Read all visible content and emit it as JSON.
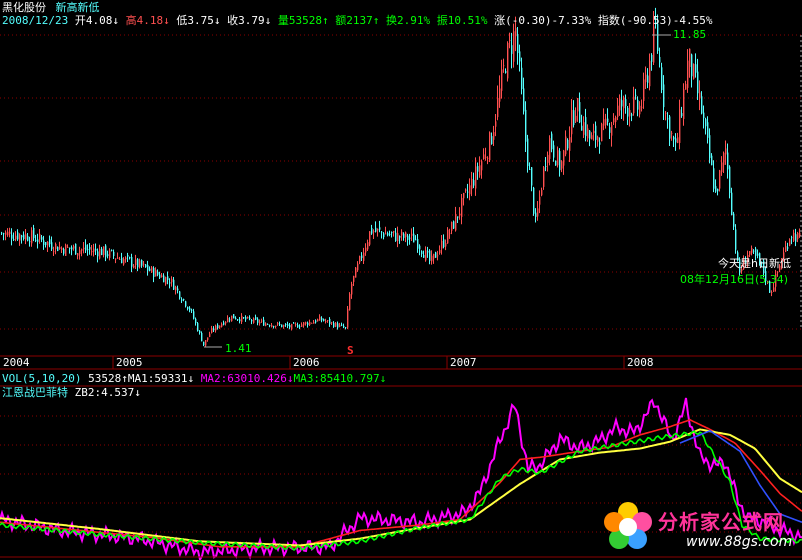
{
  "stock": {
    "name": "黑化股份",
    "indicator_name": "新高新低",
    "date": "2008/12/23",
    "open_label": "开",
    "open": "4.08",
    "high_label": "高",
    "high": "4.18",
    "low_label": "低",
    "low": "3.75",
    "close_label": "收",
    "close": "3.79",
    "volume_label": "量",
    "volume": "53528",
    "amount_label": "额",
    "amount": "2137",
    "turnover_label": "换",
    "turnover": "2.91%",
    "amplitude_label": "振",
    "amplitude": "10.51%",
    "change_label": "涨",
    "change": "(-0.30)-7.33%",
    "index_label": "指数",
    "index_change": "(-90.53)-4.55%",
    "arrows": {
      "down": "↓",
      "up": "↑"
    }
  },
  "price_panel": {
    "max_marker": "11.85",
    "min_marker": "1.41",
    "signal_marker": "S",
    "overlay_today": "今天是h日新低",
    "overlay_date": "08年12月16日(5.34)",
    "year_labels": [
      "2004",
      "2005",
      "2006",
      "2007",
      "2008"
    ]
  },
  "volume_panel": {
    "title": "VOL(5,10,20)",
    "value": "53528",
    "ma1_label": "MA1:",
    "ma1": "59331",
    "ma2_label": "MA2:",
    "ma2": "63010.426",
    "ma3_label": "MA3:",
    "ma3": "85410.797"
  },
  "indicator_panel": {
    "title": "江恩战巴菲特",
    "zb2_label": "ZB2:",
    "zb2": "4.537"
  },
  "watermark": {
    "brand": "分析家公式网",
    "url": "www.88gs.com"
  },
  "colors": {
    "background": "#000000",
    "grid": "#8b0000",
    "candle_up": "#ff5050",
    "candle_down": "#54ffff",
    "text_white": "#ffffff",
    "text_red": "#ff5050",
    "text_green": "#00ff00",
    "text_cyan": "#54ffff",
    "text_magenta": "#ff00ff",
    "text_yellow": "#ffff00",
    "line_magenta": "#ff00ff",
    "line_red": "#ff2020",
    "line_yellow": "#ffff40",
    "line_green": "#00ff00",
    "line_blue": "#3050ff"
  },
  "chart_data": {
    "type": "line",
    "title": "黑化股份 新高新低",
    "y_range_price": [
      1.41,
      11.85
    ],
    "x_years": [
      "2004",
      "2005",
      "2006",
      "2007",
      "2008"
    ],
    "price_anchors": [
      [
        0,
        5.2
      ],
      [
        30,
        5.1
      ],
      [
        60,
        4.7
      ],
      [
        100,
        4.6
      ],
      [
        140,
        4.1
      ],
      [
        170,
        3.6
      ],
      [
        190,
        2.6
      ],
      [
        203,
        1.45
      ],
      [
        210,
        1.9
      ],
      [
        230,
        2.4
      ],
      [
        260,
        2.2
      ],
      [
        290,
        2.05
      ],
      [
        320,
        2.3
      ],
      [
        345,
        2.0
      ],
      [
        350,
        3.4
      ],
      [
        370,
        5.3
      ],
      [
        395,
        5.1
      ],
      [
        415,
        5.0
      ],
      [
        430,
        4.2
      ],
      [
        450,
        5.3
      ],
      [
        470,
        6.8
      ],
      [
        490,
        8.3
      ],
      [
        505,
        11.0
      ],
      [
        515,
        12.0
      ],
      [
        525,
        8.3
      ],
      [
        535,
        5.5
      ],
      [
        548,
        8.4
      ],
      [
        560,
        7.4
      ],
      [
        575,
        9.5
      ],
      [
        590,
        8.3
      ],
      [
        605,
        8.7
      ],
      [
        620,
        9.5
      ],
      [
        640,
        9.4
      ],
      [
        655,
        12.0
      ],
      [
        665,
        9.2
      ],
      [
        675,
        8.0
      ],
      [
        688,
        11.1
      ],
      [
        700,
        9.5
      ],
      [
        715,
        6.5
      ],
      [
        725,
        8.0
      ],
      [
        738,
        3.8
      ],
      [
        748,
        4.6
      ],
      [
        760,
        4.2
      ],
      [
        770,
        3.2
      ],
      [
        790,
        5.2
      ],
      [
        800,
        5.0
      ]
    ],
    "zb_series": [
      {
        "name": "magenta",
        "color": "#ff00ff",
        "points": [
          [
            0,
            3.6
          ],
          [
            60,
            2.8
          ],
          [
            140,
            2.2
          ],
          [
            200,
            1.2
          ],
          [
            260,
            1.5
          ],
          [
            330,
            1.6
          ],
          [
            360,
            3.7
          ],
          [
            420,
            3.4
          ],
          [
            465,
            4.1
          ],
          [
            480,
            5.6
          ],
          [
            500,
            9.4
          ],
          [
            515,
            12.0
          ],
          [
            528,
            7.3
          ],
          [
            540,
            7.6
          ],
          [
            560,
            9.5
          ],
          [
            580,
            8.8
          ],
          [
            600,
            9.4
          ],
          [
            615,
            10.3
          ],
          [
            635,
            10.0
          ],
          [
            655,
            12.3
          ],
          [
            672,
            9.4
          ],
          [
            686,
            12.0
          ],
          [
            700,
            8.2
          ],
          [
            715,
            7.5
          ],
          [
            725,
            7.9
          ],
          [
            738,
            5.0
          ],
          [
            748,
            3.7
          ],
          [
            762,
            3.5
          ],
          [
            775,
            3.0
          ],
          [
            790,
            2.6
          ],
          [
            802,
            2.3
          ]
        ]
      },
      {
        "name": "red",
        "color": "#ff2020",
        "points": [
          [
            0,
            3.4
          ],
          [
            80,
            2.8
          ],
          [
            150,
            2.3
          ],
          [
            220,
            1.6
          ],
          [
            300,
            1.6
          ],
          [
            360,
            2.8
          ],
          [
            420,
            3.2
          ],
          [
            460,
            3.6
          ],
          [
            500,
            6.3
          ],
          [
            520,
            8.0
          ],
          [
            545,
            8.2
          ],
          [
            580,
            8.6
          ],
          [
            610,
            8.9
          ],
          [
            640,
            9.8
          ],
          [
            670,
            10.4
          ],
          [
            690,
            10.9
          ],
          [
            710,
            10.2
          ],
          [
            735,
            9.2
          ],
          [
            760,
            7.2
          ],
          [
            780,
            5.5
          ],
          [
            802,
            4.2
          ]
        ]
      },
      {
        "name": "yellow",
        "color": "#ffff40",
        "points": [
          [
            0,
            3.7
          ],
          [
            100,
            2.9
          ],
          [
            200,
            2.0
          ],
          [
            300,
            1.7
          ],
          [
            360,
            2.2
          ],
          [
            420,
            3.0
          ],
          [
            470,
            3.6
          ],
          [
            520,
            6.2
          ],
          [
            560,
            8.0
          ],
          [
            600,
            8.5
          ],
          [
            640,
            8.8
          ],
          [
            670,
            9.3
          ],
          [
            700,
            10.2
          ],
          [
            730,
            9.8
          ],
          [
            755,
            8.8
          ],
          [
            780,
            6.6
          ],
          [
            802,
            5.6
          ]
        ]
      },
      {
        "name": "green",
        "color": "#00ff00",
        "points": [
          [
            0,
            3.2
          ],
          [
            100,
            2.5
          ],
          [
            200,
            1.9
          ],
          [
            300,
            1.5
          ],
          [
            360,
            2.0
          ],
          [
            420,
            3.0
          ],
          [
            470,
            3.6
          ],
          [
            500,
            6.6
          ],
          [
            520,
            7.3
          ],
          [
            540,
            7.0
          ],
          [
            580,
            8.6
          ],
          [
            620,
            9.1
          ],
          [
            660,
            9.6
          ],
          [
            700,
            10.0
          ],
          [
            720,
            7.6
          ],
          [
            730,
            6.3
          ],
          [
            742,
            3.2
          ],
          [
            760,
            2.2
          ],
          [
            802,
            2.0
          ]
        ]
      },
      {
        "name": "blue",
        "color": "#3050ff",
        "points": [
          [
            680,
            9.2
          ],
          [
            710,
            10.1
          ],
          [
            740,
            8.6
          ],
          [
            760,
            6.1
          ],
          [
            780,
            4.0
          ],
          [
            802,
            3.4
          ]
        ]
      }
    ]
  }
}
